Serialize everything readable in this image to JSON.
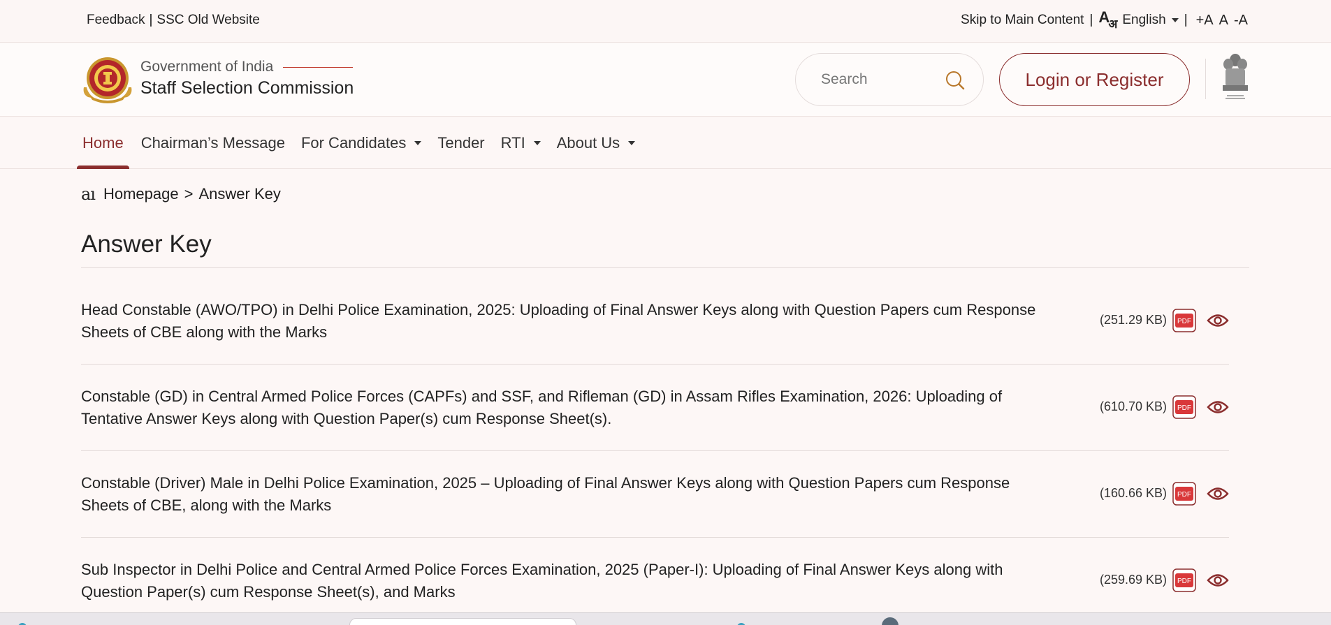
{
  "topbar": {
    "feedback": "Feedback",
    "old_website": "SSC Old Website",
    "skip": "Skip to Main Content",
    "language": "English",
    "font_increase": "+A",
    "font_normal": "A",
    "font_decrease": "-A"
  },
  "header": {
    "org_sub": "Government of India",
    "org_title": "Staff Selection Commission",
    "search_placeholder": "Search",
    "login_label": "Login or Register"
  },
  "nav": {
    "items": [
      "Home",
      "Chairman’s Message",
      "For Candidates",
      "Tender",
      "RTI",
      "About Us"
    ]
  },
  "breadcrumb": {
    "icon_text": "aı",
    "home": "Homepage",
    "separator": ">",
    "current": "Answer Key"
  },
  "page_title": "Answer Key",
  "items": [
    {
      "title": "Head Constable (AWO/TPO) in Delhi Police Examination, 2025: Uploading of Final Answer Keys along with Question Papers cum Response Sheets of CBE along with the Marks",
      "size": "(251.29 KB)"
    },
    {
      "title": "Constable (GD) in Central Armed Police Forces (CAPFs) and SSF, and Rifleman (GD) in Assam Rifles Examination, 2026: Uploading of Tentative Answer Keys along with Question Paper(s) cum Response Sheet(s).",
      "size": "(610.70 KB)"
    },
    {
      "title": "Constable (Driver) Male in Delhi Police Examination, 2025 – Uploading of Final Answer Keys along with Question Papers cum Response Sheets of CBE, along with the Marks",
      "size": "(160.66 KB)"
    },
    {
      "title": "Sub Inspector in Delhi Police and Central Armed Police Forces Examination, 2025 (Paper-I): Uploading of Final Answer Keys along with Question Paper(s) cum Response Sheet(s), and Marks",
      "size": "(259.69 KB)"
    }
  ],
  "pdf_label": "PDF",
  "colors": {
    "brand": "#8b2e2e",
    "pdf_red": "#d9383a",
    "background": "#fdf7f6"
  },
  "icons": [
    "search-icon",
    "pdf-icon",
    "eye-icon",
    "ssc-logo",
    "national-emblem"
  ]
}
